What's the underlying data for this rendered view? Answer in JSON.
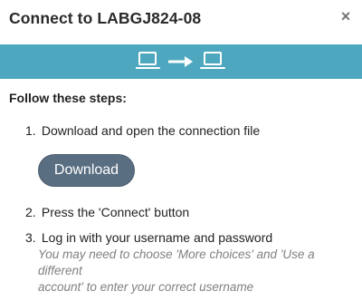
{
  "dialog": {
    "title": "Connect to LABGJ824-08",
    "close_glyph": "×",
    "colors": {
      "banner": "#4da8bf",
      "button": "#5a6e82",
      "note": "#808080"
    },
    "banner_icons": [
      "laptop-icon",
      "arrow-right-icon",
      "laptop-icon"
    ]
  },
  "steps": {
    "heading": "Follow these steps:",
    "items": [
      {
        "num": "1.",
        "text": "Download and open the connection file"
      },
      {
        "num": "2.",
        "text": "Press the 'Connect' button"
      },
      {
        "num": "3.",
        "text": "Log in with your username and password"
      }
    ],
    "download_label": "Download",
    "note_line1": "You may need to choose 'More choices' and 'Use a different",
    "note_line2": "account' to enter your correct username"
  }
}
